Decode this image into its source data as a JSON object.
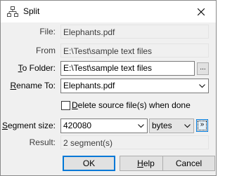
{
  "window": {
    "title": "Split",
    "title_icon": "sitemap-icon",
    "close_icon": "close-icon"
  },
  "fields": {
    "file_label": "File:",
    "file_value": "Elephants.pdf",
    "from_label": "From",
    "from_value": "E:\\Test\\sample text files",
    "to_folder_label_u": "T",
    "to_folder_label_rest": "o Folder:",
    "to_folder_value": "E:\\Test\\sample text files",
    "browse_label": "...",
    "rename_label_u": "R",
    "rename_label_rest": "ename To:",
    "rename_value": "Elephants.pdf"
  },
  "delete_source": {
    "label_u": "D",
    "label_rest": "elete source file(s) when done",
    "checked": false
  },
  "segment": {
    "label_u": "S",
    "label_rest": "egment size:",
    "value": "420080",
    "unit": "bytes",
    "next_label": "»"
  },
  "result": {
    "label": "Result:",
    "value": "2 segment(s)"
  },
  "buttons": {
    "ok": "OK",
    "help_u": "H",
    "help_rest": "elp",
    "cancel": "Cancel"
  }
}
